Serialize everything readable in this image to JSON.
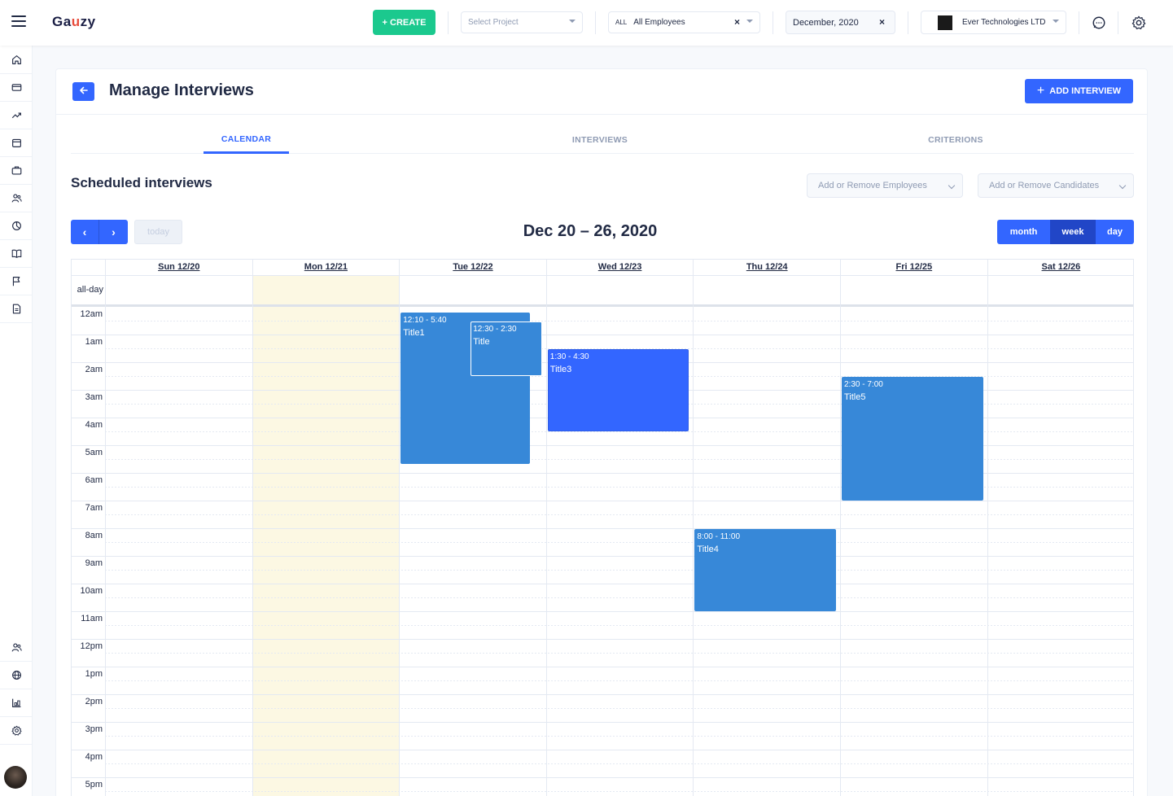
{
  "header": {
    "logo_text": "Gauzy",
    "create_label": "+ CREATE",
    "project_placeholder": "Select Project",
    "employees_prefix": "ALL",
    "employees_value": "All Employees",
    "date_value": "December, 2020",
    "company_value": "Ever Technologies LTD",
    "clear_symbol": "×"
  },
  "sidebar": {
    "items": [
      "home-icon",
      "credit-card-icon",
      "trending-up-icon",
      "calendar-icon",
      "briefcase-icon",
      "people-icon",
      "pie-chart-icon",
      "book-icon",
      "flag-icon",
      "file-icon"
    ],
    "bottom_items": [
      "people-icon",
      "globe-icon",
      "layers-icon",
      "settings-icon"
    ]
  },
  "page": {
    "title": "Manage Interviews",
    "add_button": "ADD INTERVIEW",
    "tabs": [
      {
        "label": "CALENDAR",
        "active": true
      },
      {
        "label": "INTERVIEWS",
        "active": false
      },
      {
        "label": "CRITERIONS",
        "active": false
      }
    ],
    "section_title": "Scheduled interviews",
    "employees_filter_placeholder": "Add or Remove Employees",
    "candidates_filter_placeholder": "Add or Remove Candidates"
  },
  "calendar": {
    "title": "Dec 20 – 26, 2020",
    "prev_symbol": "‹",
    "next_symbol": "›",
    "today_label": "today",
    "views": [
      {
        "label": "month",
        "active": false
      },
      {
        "label": "week",
        "active": true
      },
      {
        "label": "day",
        "active": false
      }
    ],
    "allday_label": "all-day",
    "days": [
      "Sun 12/20",
      "Mon 12/21",
      "Tue 12/22",
      "Wed 12/23",
      "Thu 12/24",
      "Fri 12/25",
      "Sat 12/26"
    ],
    "today_index": 1,
    "hours": [
      "12am",
      "1am",
      "2am",
      "3am",
      "4am",
      "5am",
      "6am",
      "7am",
      "8am",
      "9am",
      "10am",
      "11am",
      "12pm",
      "1pm",
      "2pm",
      "3pm",
      "4pm",
      "5pm"
    ],
    "events": [
      {
        "day": 2,
        "start": 0.1667,
        "end": 5.6667,
        "time": "12:10 - 5:40",
        "title": "Title1",
        "style": "light"
      },
      {
        "day": 2,
        "start": 0.5,
        "end": 2.5,
        "time": "12:30 - 2:30",
        "title": "Title",
        "style": "light-outline"
      },
      {
        "day": 3,
        "start": 1.5,
        "end": 4.5,
        "time": "1:30 - 4:30",
        "title": "Title3",
        "style": "dark"
      },
      {
        "day": 4,
        "start": 8,
        "end": 11,
        "time": "8:00 - 11:00",
        "title": "Title4",
        "style": "light"
      },
      {
        "day": 5,
        "start": 2.5,
        "end": 7,
        "time": "2:30 - 7:00",
        "title": "Title5",
        "style": "light"
      }
    ]
  }
}
